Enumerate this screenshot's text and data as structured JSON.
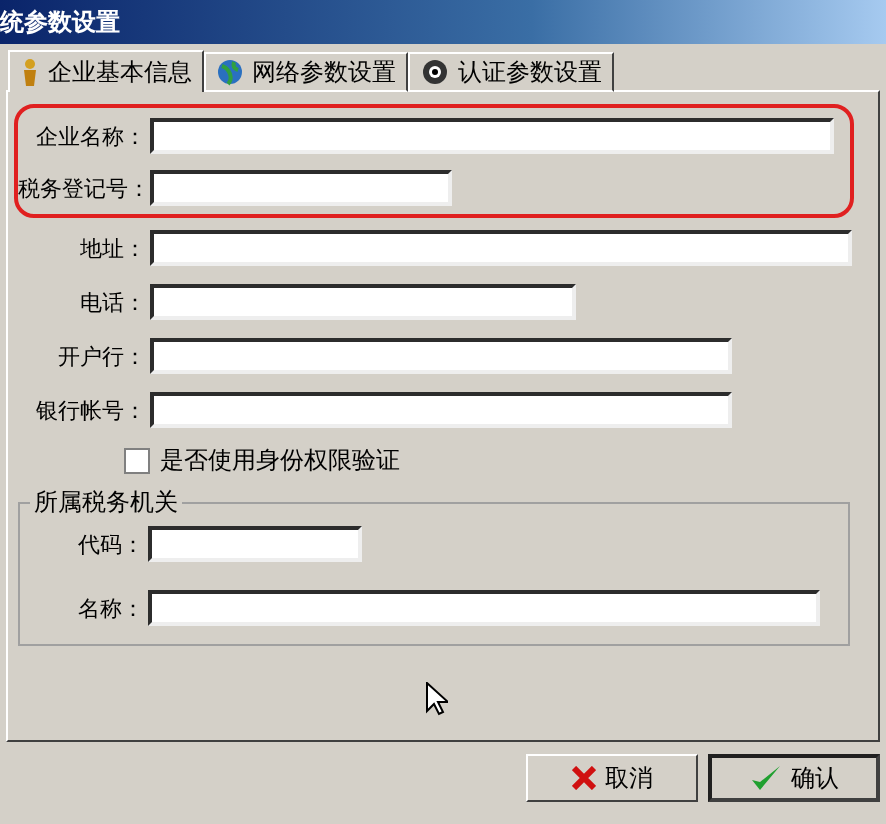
{
  "window": {
    "title": "统参数设置"
  },
  "tabs": [
    {
      "label": "企业基本信息",
      "selected": true
    },
    {
      "label": "网络参数设置",
      "selected": false
    },
    {
      "label": "认证参数设置",
      "selected": false
    }
  ],
  "fields": [
    {
      "label": "企业名称：",
      "highlighted": true
    },
    {
      "label": "税务登记号：",
      "highlighted": true
    },
    {
      "label": "地址：",
      "highlighted": false
    },
    {
      "label": "电话：",
      "highlighted": false
    },
    {
      "label": "开户行：",
      "highlighted": false
    },
    {
      "label": "银行帐号：",
      "highlighted": false
    }
  ],
  "checkbox": {
    "label": "是否使用身份权限验证",
    "checked": false
  },
  "tax_authority": {
    "title": "所属税务机关",
    "fields": [
      {
        "label": "代码："
      },
      {
        "label": "名称："
      }
    ]
  },
  "buttons": [
    {
      "label": "取消",
      "kind": "cancel",
      "default": false
    },
    {
      "label": "确认",
      "kind": "ok",
      "default": true
    }
  ]
}
